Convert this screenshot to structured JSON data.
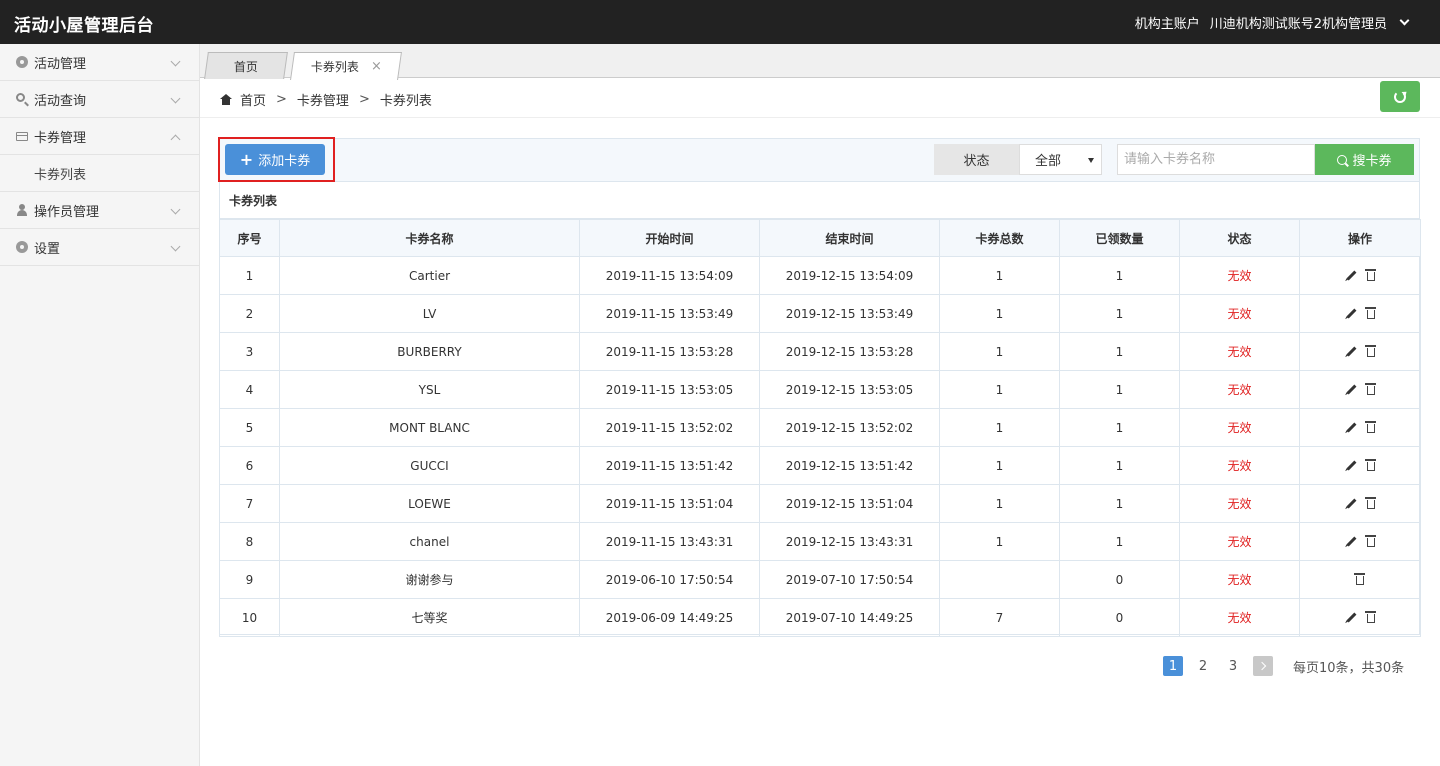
{
  "header": {
    "app_title": "活动小屋管理后台",
    "account_type": "机构主账户",
    "user_name": "川迪机构测试账号2机构管理员"
  },
  "sidebar": {
    "items": [
      {
        "label": "活动管理",
        "icon": "gear-icon",
        "expanded": false
      },
      {
        "label": "活动查询",
        "icon": "search-icon",
        "expanded": false
      },
      {
        "label": "卡券管理",
        "icon": "card-icon",
        "expanded": true,
        "children": [
          {
            "label": "卡券列表"
          }
        ]
      },
      {
        "label": "操作员管理",
        "icon": "user-icon",
        "expanded": false
      },
      {
        "label": "设置",
        "icon": "gear-icon",
        "expanded": false
      }
    ]
  },
  "tabs": [
    {
      "label": "首页",
      "active": false
    },
    {
      "label": "卡券列表",
      "active": true,
      "close": "×"
    }
  ],
  "breadcrumb": {
    "items": [
      "首页",
      "卡券管理",
      "卡券列表"
    ],
    "separator": ">"
  },
  "toolbar": {
    "add_label": "添加卡券",
    "status_label": "状态",
    "status_value": "全部",
    "search_placeholder": "请输入卡券名称",
    "search_label": "搜卡券"
  },
  "list_title": "卡券列表",
  "table": {
    "columns": [
      "序号",
      "卡券名称",
      "开始时间",
      "结束时间",
      "卡券总数",
      "已领数量",
      "状态",
      "操作"
    ],
    "rows": [
      {
        "idx": "1",
        "name": "Cartier",
        "start": "2019-11-15 13:54:09",
        "end": "2019-12-15 13:54:09",
        "total": "1",
        "claimed": "1",
        "status": "无效",
        "editable": true
      },
      {
        "idx": "2",
        "name": "LV",
        "start": "2019-11-15 13:53:49",
        "end": "2019-12-15 13:53:49",
        "total": "1",
        "claimed": "1",
        "status": "无效",
        "editable": true
      },
      {
        "idx": "3",
        "name": "BURBERRY",
        "start": "2019-11-15 13:53:28",
        "end": "2019-12-15 13:53:28",
        "total": "1",
        "claimed": "1",
        "status": "无效",
        "editable": true
      },
      {
        "idx": "4",
        "name": "YSL",
        "start": "2019-11-15 13:53:05",
        "end": "2019-12-15 13:53:05",
        "total": "1",
        "claimed": "1",
        "status": "无效",
        "editable": true
      },
      {
        "idx": "5",
        "name": "MONT BLANC",
        "start": "2019-11-15 13:52:02",
        "end": "2019-12-15 13:52:02",
        "total": "1",
        "claimed": "1",
        "status": "无效",
        "editable": true
      },
      {
        "idx": "6",
        "name": "GUCCI",
        "start": "2019-11-15 13:51:42",
        "end": "2019-12-15 13:51:42",
        "total": "1",
        "claimed": "1",
        "status": "无效",
        "editable": true
      },
      {
        "idx": "7",
        "name": "LOEWE",
        "start": "2019-11-15 13:51:04",
        "end": "2019-12-15 13:51:04",
        "total": "1",
        "claimed": "1",
        "status": "无效",
        "editable": true
      },
      {
        "idx": "8",
        "name": "chanel",
        "start": "2019-11-15 13:43:31",
        "end": "2019-12-15 13:43:31",
        "total": "1",
        "claimed": "1",
        "status": "无效",
        "editable": true
      },
      {
        "idx": "9",
        "name": "谢谢参与",
        "start": "2019-06-10 17:50:54",
        "end": "2019-07-10 17:50:54",
        "total": "",
        "claimed": "0",
        "status": "无效",
        "editable": false
      },
      {
        "idx": "10",
        "name": "七等奖",
        "start": "2019-06-09 14:49:25",
        "end": "2019-07-10 14:49:25",
        "total": "7",
        "claimed": "0",
        "status": "无效",
        "editable": true
      }
    ]
  },
  "pagination": {
    "pages": [
      "1",
      "2",
      "3"
    ],
    "current": "1",
    "summary": "每页10条，共30条"
  },
  "colors": {
    "topbar": "#222222",
    "primary": "#4a90d9",
    "success": "#5cb85c",
    "invalid_status": "#e02020"
  }
}
